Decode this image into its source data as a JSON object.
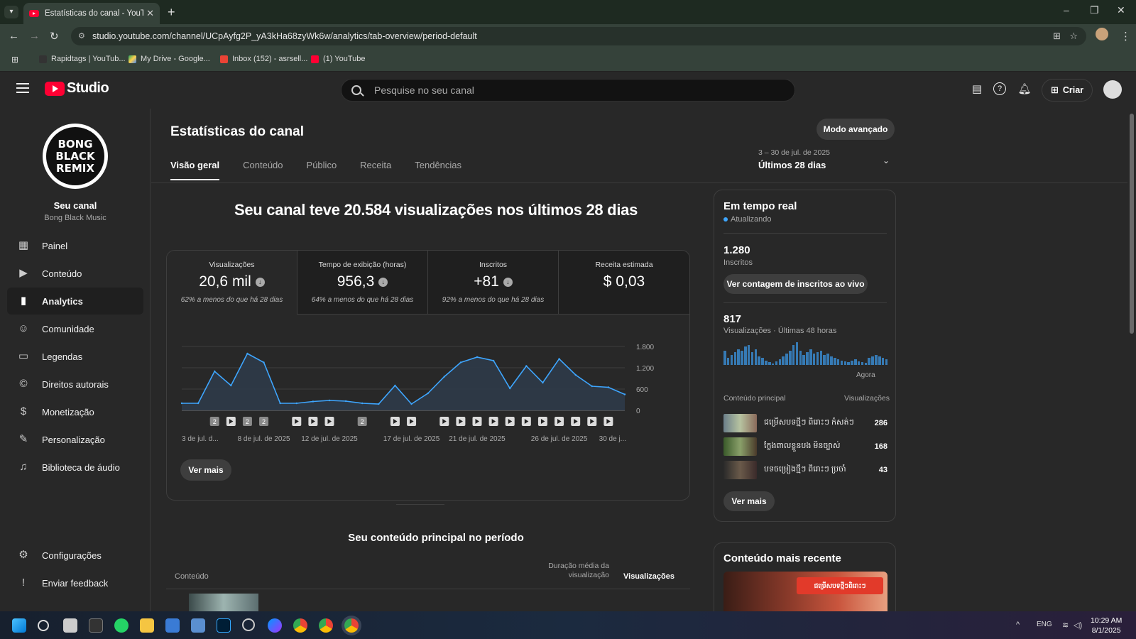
{
  "browser": {
    "tab_title": "Estatísticas do canal - YouTube Studio",
    "url": "studio.youtube.com/channel/UCpAyfg2P_yA3kHa68zyWk6w/analytics/tab-overview/period-default",
    "bookmarks": [
      "Rapidtags | YouTub...",
      "My Drive - Google...",
      "Inbox (152) - asrsell...",
      "(1) YouTube"
    ]
  },
  "header": {
    "logo_text": "Studio",
    "search_placeholder": "Pesquise no seu canal",
    "create_label": "Criar"
  },
  "sidebar": {
    "channel_title": "Seu canal",
    "channel_name": "Bong Black Music",
    "avatar_text": "BONG BLACK REMIX",
    "items": [
      {
        "label": "Painel",
        "icon": "dashboard-icon"
      },
      {
        "label": "Conteúdo",
        "icon": "content-icon"
      },
      {
        "label": "Analytics",
        "icon": "analytics-icon"
      },
      {
        "label": "Comunidade",
        "icon": "community-icon"
      },
      {
        "label": "Legendas",
        "icon": "subtitles-icon"
      },
      {
        "label": "Direitos autorais",
        "icon": "copyright-icon"
      },
      {
        "label": "Monetização",
        "icon": "monetization-icon"
      },
      {
        "label": "Personalização",
        "icon": "customization-icon"
      },
      {
        "label": "Biblioteca de áudio",
        "icon": "audio-library-icon"
      }
    ],
    "bottom": [
      {
        "label": "Configurações",
        "icon": "settings-icon"
      },
      {
        "label": "Enviar feedback",
        "icon": "feedback-icon"
      }
    ]
  },
  "page": {
    "title": "Estatísticas do canal",
    "advanced_mode": "Modo avançado",
    "tabs": [
      "Visão geral",
      "Conteúdo",
      "Público",
      "Receita",
      "Tendências"
    ],
    "date_range": "3 – 30 de jul. de 2025",
    "period": "Últimos 28 dias",
    "headline": "Seu canal teve 20.584 visualizações nos últimos 28 dias",
    "metrics": [
      {
        "label": "Visualizações",
        "value": "20,6 mil",
        "note": "62% a menos do que há 28 dias",
        "trend": "down"
      },
      {
        "label": "Tempo de exibição (horas)",
        "value": "956,3",
        "note": "64% a menos do que há 28 dias",
        "trend": "down"
      },
      {
        "label": "Inscritos",
        "value": "+81",
        "note": "92% a menos do que há 28 dias",
        "trend": "down"
      },
      {
        "label": "Receita estimada",
        "value": "$ 0,03",
        "note": ""
      }
    ],
    "see_more": "Ver mais",
    "top_content_title": "Seu conteúdo principal no período",
    "table_headers": {
      "content": "Conteúdo",
      "avg_duration": "Duração média da visualização",
      "views": "Visualizações"
    }
  },
  "chart_data": {
    "type": "line",
    "x": [
      "3 de jul. de 2025",
      "4 de jul. de 2025",
      "5 de jul. de 2025",
      "6 de jul. de 2025",
      "7 de jul. de 2025",
      "8 de jul. de 2025",
      "9 de jul. de 2025",
      "10 de jul. de 2025",
      "11 de jul. de 2025",
      "12 de jul. de 2025",
      "13 de jul. de 2025",
      "14 de jul. de 2025",
      "15 de jul. de 2025",
      "16 de jul. de 2025",
      "17 de jul. de 2025",
      "18 de jul. de 2025",
      "19 de jul. de 2025",
      "20 de jul. de 2025",
      "21 de jul. de 2025",
      "22 de jul. de 2025",
      "23 de jul. de 2025",
      "24 de jul. de 2025",
      "25 de jul. de 2025",
      "26 de jul. de 2025",
      "27 de jul. de 2025",
      "28 de jul. de 2025",
      "29 de jul. de 2025",
      "30 de jul. de 2025"
    ],
    "tick_labels": [
      "3 de jul. d...",
      "8 de jul. de 2025",
      "12 de jul. de 2025",
      "17 de jul. de 2025",
      "21 de jul. de 2025",
      "26 de jul. de 2025",
      "30 de j..."
    ],
    "tick_indices": [
      0,
      5,
      9,
      14,
      18,
      23,
      27
    ],
    "series": [
      {
        "values": [
          200,
          200,
          1100,
          700,
          1600,
          1350,
          200,
          200,
          250,
          280,
          260,
          200,
          180,
          700,
          180,
          480,
          950,
          1350,
          1500,
          1400,
          620,
          1250,
          780,
          1450,
          1000,
          680,
          650,
          450
        ]
      }
    ],
    "ylim": [
      0,
      1800
    ],
    "y_ticks": [
      "1.800",
      "1.200",
      "600",
      "0"
    ],
    "y_tick_values": [
      1800,
      1200,
      600,
      0
    ],
    "markers": [
      {
        "i": 2,
        "kind": "count",
        "label": "2"
      },
      {
        "i": 3,
        "kind": "video"
      },
      {
        "i": 4,
        "kind": "count",
        "label": "2"
      },
      {
        "i": 5,
        "kind": "count",
        "label": "2"
      },
      {
        "i": 7,
        "kind": "video"
      },
      {
        "i": 8,
        "kind": "video"
      },
      {
        "i": 9,
        "kind": "video"
      },
      {
        "i": 11,
        "kind": "count",
        "label": "2"
      },
      {
        "i": 13,
        "kind": "video"
      },
      {
        "i": 14,
        "kind": "video"
      },
      {
        "i": 16,
        "kind": "video"
      },
      {
        "i": 17,
        "kind": "video"
      },
      {
        "i": 18,
        "kind": "video"
      },
      {
        "i": 19,
        "kind": "video"
      },
      {
        "i": 20,
        "kind": "video"
      },
      {
        "i": 21,
        "kind": "video"
      },
      {
        "i": 22,
        "kind": "video"
      },
      {
        "i": 23,
        "kind": "video"
      },
      {
        "i": 24,
        "kind": "video"
      },
      {
        "i": 25,
        "kind": "video"
      },
      {
        "i": 26,
        "kind": "video"
      }
    ],
    "colors": {
      "line": "#3ea6ff",
      "fill": "#2d3a48"
    }
  },
  "realtime": {
    "title": "Em tempo real",
    "status": "Atualizando",
    "subscribers_value": "1.280",
    "subscribers_label": "Inscritos",
    "live_count_button": "Ver contagem de inscritos ao vivo",
    "views_value": "817",
    "views_label": "Visualizações · Últimas 48 horas",
    "now_label": "Agora",
    "bars": [
      20,
      10,
      14,
      18,
      22,
      20,
      26,
      28,
      18,
      22,
      12,
      10,
      6,
      4,
      2,
      5,
      8,
      12,
      16,
      20,
      28,
      32,
      20,
      14,
      18,
      22,
      16,
      18,
      20,
      14,
      16,
      12,
      10,
      8,
      6,
      5,
      4,
      6,
      8,
      5,
      4,
      3,
      10,
      12,
      14,
      12,
      10,
      8
    ],
    "content_header": "Conteúdo principal",
    "views_header": "Visualizações",
    "top_items": [
      {
        "title": "ជម្រើសបទថ្មីៗ ពិរោះៗ កំសត់ៗ",
        "views": "286",
        "thumb": "#6b7f8a"
      },
      {
        "title": "ក្លែងពាលខ្លួនបង មិនច្បាស់",
        "views": "168",
        "thumb": "#4a6a3a"
      },
      {
        "title": "បទចម្រៀងថ្មីៗ ពិរោះៗ ប្រចាំ",
        "views": "43",
        "thumb": "#5a3a2a"
      }
    ],
    "see_more": "Ver mais"
  },
  "recent": {
    "title": "Conteúdo mais recente",
    "banner_text": "ជម្រើសបទថ្មីៗពិរោះៗ"
  },
  "taskbar": {
    "lang": "ENG",
    "time": "10:29 AM",
    "date": "8/1/2025"
  }
}
